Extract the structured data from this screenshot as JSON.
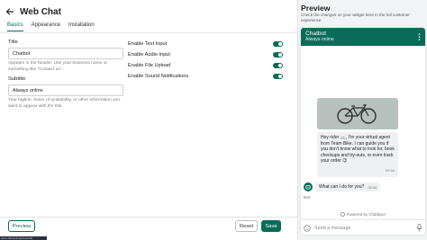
{
  "header": {
    "title": "Web Chat"
  },
  "tabs": [
    {
      "label": "Basics",
      "active": true
    },
    {
      "label": "Appearance",
      "active": false
    },
    {
      "label": "Installation",
      "active": false
    }
  ],
  "form": {
    "title_label": "Title",
    "title_value": "Chatbot",
    "title_help": "Appears in the header. Use your business name or something like \"Contact us\".",
    "subtitle_label": "Subtitle",
    "subtitle_value": "Always online",
    "subtitle_help": "Your tagline, hours of availability, or other information you want to appear with the title."
  },
  "toggles": [
    {
      "label": "Enable Text Input",
      "on": true
    },
    {
      "label": "Enable Audio Input",
      "on": true
    },
    {
      "label": "Enable File Upload",
      "on": true
    },
    {
      "label": "Enable Sound Notifications",
      "on": true
    }
  ],
  "buttons": {
    "preview": "Preview",
    "reset": "Reset",
    "save": "Save"
  },
  "footer": {
    "url": "web.chat/settings/webchat"
  },
  "preview": {
    "title": "Preview",
    "description": "Check the changes on your widget here in the full customer experience",
    "widget": {
      "name": "Chatbot",
      "status": "Always online",
      "bot_message": "Hey rider 🚲, I'm your virtual agent from Team Bike. I can guide you if you don't know what to look for, book checkups and try-outs, or even track your order 😉",
      "bot_message_time": "09:34",
      "user_message": "What can I do for you?",
      "user_message_time": "09:34",
      "sender_label": "Bot",
      "powered_by": "Powered by Chatlayer",
      "composer_placeholder": "Send a message"
    }
  },
  "colors": {
    "accent": "#0b6b5b",
    "panel_bg": "#f2f3f5"
  }
}
